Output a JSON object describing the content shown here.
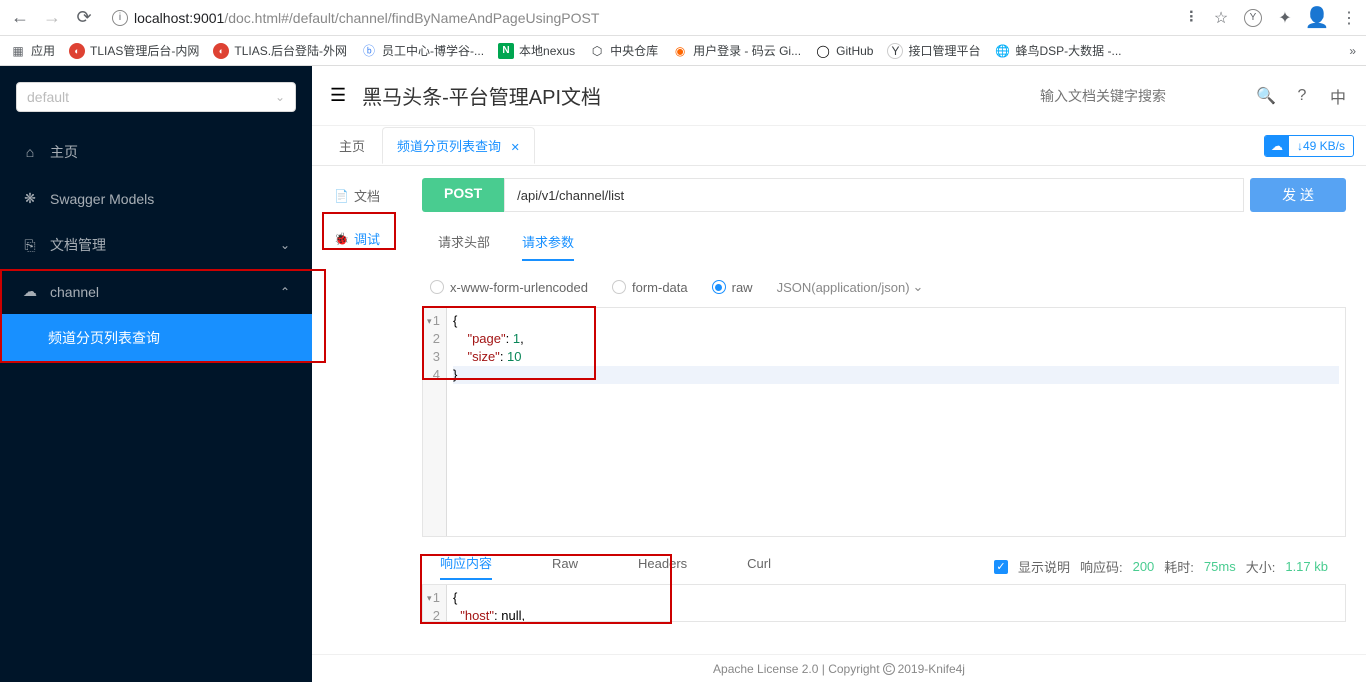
{
  "browser": {
    "url_host": "localhost:",
    "url_port": "9001",
    "url_path": "/doc.html#/default/channel/findByNameAndPageUsingPOST"
  },
  "bookmarks": {
    "apps": "应用",
    "b1": "TLIAS管理后台-内网",
    "b2": "TLIAS.后台登陆-外网",
    "b3": "员工中心-博学谷-...",
    "b4": "本地nexus",
    "b5": "中央仓库",
    "b6": "用户登录 - 码云 Gi...",
    "b7": "GitHub",
    "b8": "接口管理平台",
    "b9": "蜂鸟DSP-大数据 -..."
  },
  "sidebar": {
    "select": "default",
    "home": "主页",
    "swagger": "Swagger Models",
    "docs": "文档管理",
    "channel": "channel",
    "channel_sub": "频道分页列表查询"
  },
  "header": {
    "title": "黑马头条-平台管理API文档",
    "search_placeholder": "输入文档关键字搜索",
    "lang": "中"
  },
  "tabs": {
    "home": "主页",
    "t1": "频道分页列表查询",
    "speed": "49 KB/s"
  },
  "sidetabs": {
    "doc": "文档",
    "debug": "调试"
  },
  "api": {
    "method": "POST",
    "url": "/api/v1/channel/list",
    "send": "发 送"
  },
  "paramtabs": {
    "headers": "请求头部",
    "params": "请求参数"
  },
  "bodytype": {
    "urlencoded": "x-www-form-urlencoded",
    "formdata": "form-data",
    "raw": "raw",
    "json": "JSON(application/json)"
  },
  "reqbody": {
    "l1": "{",
    "l2_key": "\"page\"",
    "l2_val": "1",
    "l3_key": "\"size\"",
    "l3_val": "10",
    "l4": "}"
  },
  "resptabs": {
    "content": "响应内容",
    "raw": "Raw",
    "headers": "Headers",
    "curl": "Curl"
  },
  "respinfo": {
    "show_desc": "显示说明",
    "code_label": "响应码:",
    "code": "200",
    "time_label": "耗时:",
    "time": "75ms",
    "size_label": "大小:",
    "size": "1.17 kb"
  },
  "respbody": {
    "l1": "{",
    "l2_key": "\"host\"",
    "l2_val": "null"
  },
  "footer": {
    "text1": "Apache License 2.0 | Copyright ",
    "text2": " 2019-Knife4j"
  }
}
